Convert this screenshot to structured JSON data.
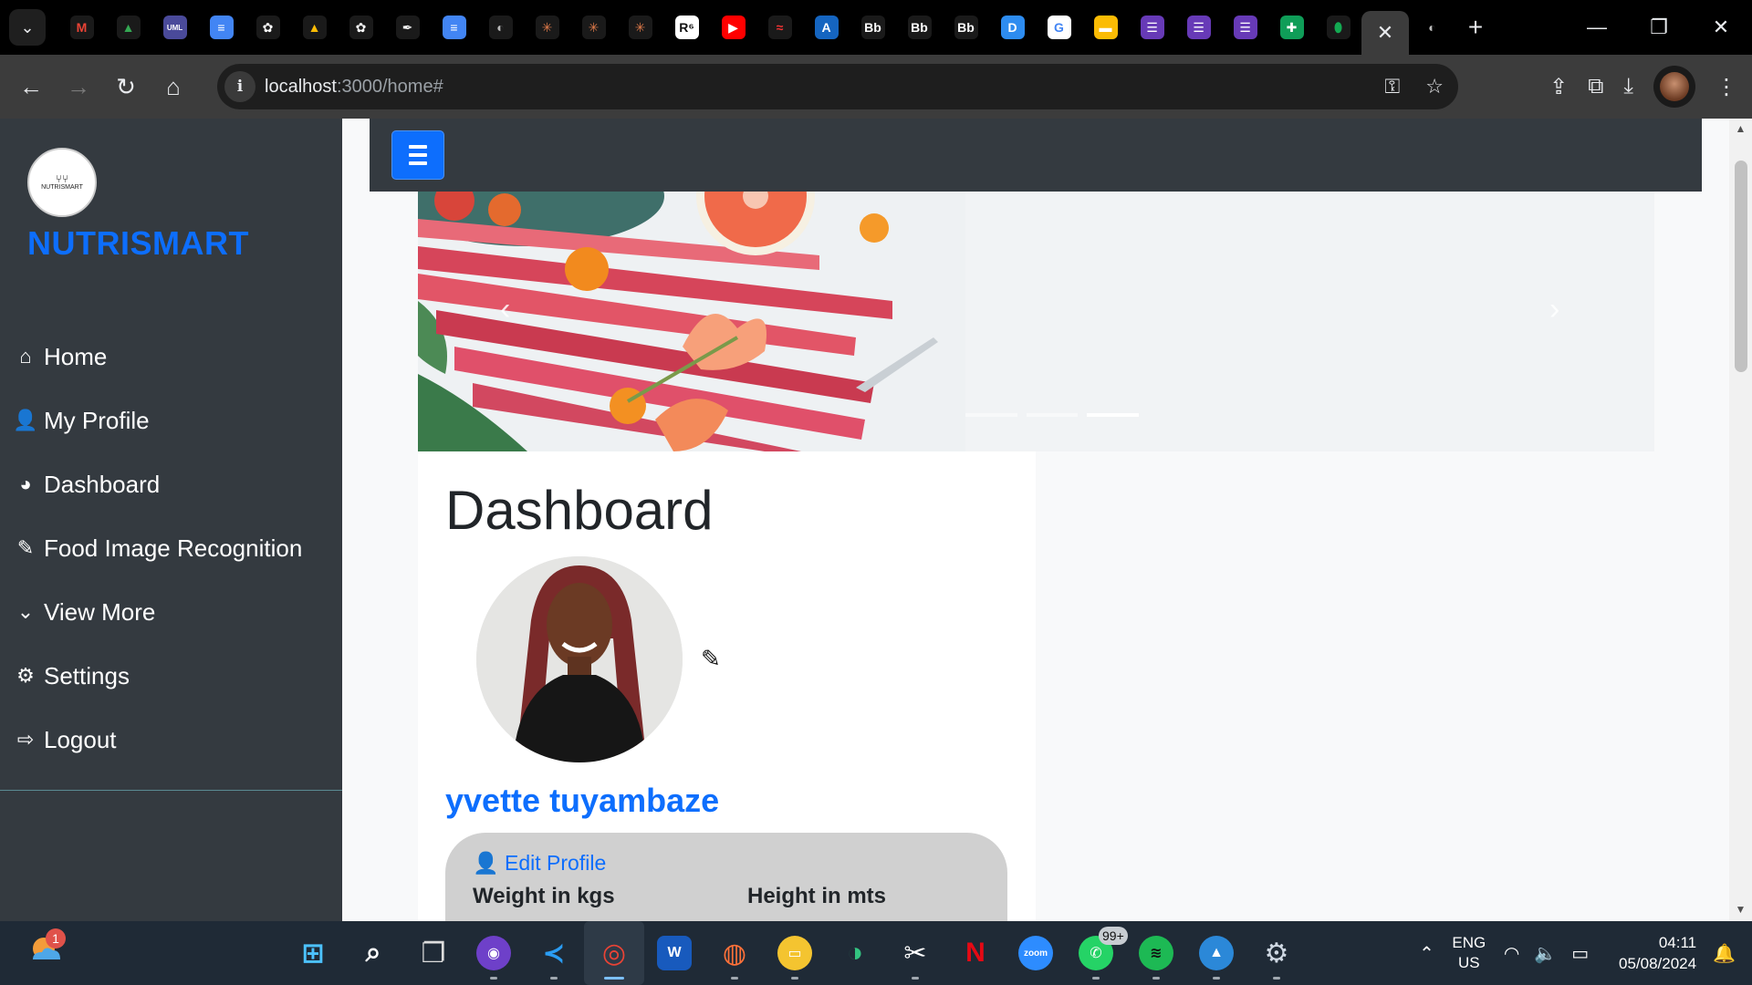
{
  "browser": {
    "tab_favicons": [
      {
        "name": "gmail-icon",
        "glyph": "M",
        "bg": "#1a1a1a",
        "color": "#ea4335"
      },
      {
        "name": "google-drive-icon",
        "glyph": "▲",
        "bg": "#1a1a1a",
        "color": "#34a853"
      },
      {
        "name": "uml-icon",
        "glyph": "UML",
        "bg": "#4a4a9a",
        "color": "#ffffff"
      },
      {
        "name": "google-docs-icon",
        "glyph": "≡",
        "bg": "#4285f4",
        "color": "#ffffff"
      },
      {
        "name": "chatgpt-icon",
        "glyph": "✿",
        "bg": "#1a1a1a",
        "color": "#ffffff"
      },
      {
        "name": "google-drive-icon",
        "glyph": "▲",
        "bg": "#1a1a1a",
        "color": "#fbbc04"
      },
      {
        "name": "chatgpt-icon",
        "glyph": "✿",
        "bg": "#1a1a1a",
        "color": "#ffffff"
      },
      {
        "name": "notion-icon",
        "glyph": "✒",
        "bg": "#1a1a1a",
        "color": "#ffffff"
      },
      {
        "name": "google-docs-icon",
        "glyph": "≡",
        "bg": "#4285f4",
        "color": "#ffffff"
      },
      {
        "name": "globe-icon",
        "glyph": "◐",
        "bg": "#1a1a1a",
        "color": "#bbbbbb"
      },
      {
        "name": "claude-icon",
        "glyph": "✳",
        "bg": "#1a1a1a",
        "color": "#e07a4a"
      },
      {
        "name": "claude-icon",
        "glyph": "✳",
        "bg": "#1a1a1a",
        "color": "#e07a4a"
      },
      {
        "name": "claude-icon",
        "glyph": "✳",
        "bg": "#1a1a1a",
        "color": "#e07a4a"
      },
      {
        "name": "r6-icon",
        "glyph": "R⁶",
        "bg": "#ffffff",
        "color": "#111111"
      },
      {
        "name": "youtube-icon",
        "glyph": "▶",
        "bg": "#ff0000",
        "color": "#ffffff"
      },
      {
        "name": "wave-icon",
        "glyph": "≈",
        "bg": "#1a1a1a",
        "color": "#e33"
      },
      {
        "name": "a-icon",
        "glyph": "A",
        "bg": "#1565c0",
        "color": "#ffffff"
      },
      {
        "name": "blackboard-icon",
        "glyph": "Bb",
        "bg": "#1a1a1a",
        "color": "#ffffff"
      },
      {
        "name": "blackboard-icon",
        "glyph": "Bb",
        "bg": "#1a1a1a",
        "color": "#ffffff"
      },
      {
        "name": "blackboard-icon",
        "glyph": "Bb",
        "bg": "#1a1a1a",
        "color": "#ffffff"
      },
      {
        "name": "d-icon",
        "glyph": "D",
        "bg": "#2d8cf0",
        "color": "#ffffff"
      },
      {
        "name": "google-icon",
        "glyph": "G",
        "bg": "#ffffff",
        "color": "#4285f4"
      },
      {
        "name": "google-slides-icon",
        "glyph": "▬",
        "bg": "#fbbc04",
        "color": "#ffffff"
      },
      {
        "name": "google-forms-icon",
        "glyph": "☰",
        "bg": "#673ab7",
        "color": "#ffffff"
      },
      {
        "name": "google-forms-icon",
        "glyph": "☰",
        "bg": "#673ab7",
        "color": "#ffffff"
      },
      {
        "name": "google-forms-icon",
        "glyph": "☰",
        "bg": "#673ab7",
        "color": "#ffffff"
      },
      {
        "name": "google-sheets-icon",
        "glyph": "✚",
        "bg": "#0f9d58",
        "color": "#ffffff"
      },
      {
        "name": "mongodb-icon",
        "glyph": "⬮",
        "bg": "#1a1a1a",
        "color": "#13aa52"
      }
    ],
    "active_tab_close": "✕",
    "after_tab_favicon": "◐",
    "new_tab": "+",
    "url_host": "localhost",
    "url_path": ":3000/home#"
  },
  "sidebar": {
    "brand": "NUTRISMART",
    "logo_text": "NUTRISMART",
    "items": [
      {
        "label": "Home",
        "icon": "⌂",
        "name": "sidebar-item-home",
        "icon_name": "home-icon"
      },
      {
        "label": "My Profile",
        "icon": "👤",
        "name": "sidebar-item-my-profile",
        "icon_name": "user-icon"
      },
      {
        "label": "Dashboard",
        "icon": "◕",
        "name": "sidebar-item-dashboard",
        "icon_name": "dashboard-gauge-icon"
      },
      {
        "label": "Food Image Recognition",
        "icon": "✎",
        "name": "sidebar-item-food-image-recognition",
        "icon_name": "carrot-icon"
      },
      {
        "label": "View More",
        "icon": "⌄",
        "name": "sidebar-item-view-more",
        "icon_name": "chevron-down-icon"
      },
      {
        "label": "Settings",
        "icon": "⚙",
        "name": "sidebar-item-settings",
        "icon_name": "gear-icon"
      },
      {
        "label": "Logout",
        "icon": "⇨",
        "name": "sidebar-item-logout",
        "icon_name": "logout-icon"
      }
    ]
  },
  "carousel": {
    "prev": "‹",
    "next": "›",
    "slide_count": 3,
    "active_slide": 3
  },
  "dashboard": {
    "title": "Dashboard",
    "user_name": "yvette tuyambaze",
    "edit_profile": "Edit Profile",
    "weight_label": "Weight in kgs",
    "height_label": "Height in mts"
  },
  "taskbar": {
    "weather_badge": "1",
    "whatsapp_badge": "99+",
    "apps": [
      {
        "name": "start-button",
        "glyph": "⊞",
        "bg": "transparent",
        "color": "#4cc2ff"
      },
      {
        "name": "search-icon",
        "glyph": "⌕",
        "bg": "transparent",
        "color": "#ffffff"
      },
      {
        "name": "task-view-icon",
        "glyph": "❐",
        "bg": "transparent",
        "color": "#dddddd"
      },
      {
        "name": "github-desktop-icon",
        "glyph": "◉",
        "bg": "#6e40c9",
        "color": "#ffffff"
      },
      {
        "name": "vscode-icon",
        "glyph": "≺",
        "bg": "transparent",
        "color": "#2a9df4"
      },
      {
        "name": "chrome-icon",
        "glyph": "◎",
        "bg": "transparent",
        "color": "#ea4335"
      },
      {
        "name": "word-icon",
        "glyph": "W",
        "bg": "#185abd",
        "color": "#ffffff"
      },
      {
        "name": "firefox-icon",
        "glyph": "◍",
        "bg": "transparent",
        "color": "#ff7139"
      },
      {
        "name": "file-explorer-icon",
        "glyph": "▭",
        "bg": "#f4c430",
        "color": "#ffffff"
      },
      {
        "name": "edge-icon",
        "glyph": "◑",
        "bg": "transparent",
        "color": "#33c481"
      },
      {
        "name": "snipping-tool-icon",
        "glyph": "✂",
        "bg": "transparent",
        "color": "#ffffff"
      },
      {
        "name": "netflix-icon",
        "glyph": "N",
        "bg": "transparent",
        "color": "#e50914"
      },
      {
        "name": "zoom-icon",
        "glyph": "zoom",
        "bg": "#2d8cff",
        "color": "#ffffff"
      },
      {
        "name": "whatsapp-icon",
        "glyph": "✆",
        "bg": "#25d366",
        "color": "#ffffff"
      },
      {
        "name": "spotify-icon",
        "glyph": "≋",
        "bg": "#1db954",
        "color": "#111111"
      },
      {
        "name": "photos-icon",
        "glyph": "▲",
        "bg": "#2b88d8",
        "color": "#ffffff"
      },
      {
        "name": "settings-icon",
        "glyph": "⚙",
        "bg": "transparent",
        "color": "#cfd8e3"
      }
    ],
    "lang_top": "ENG",
    "lang_bottom": "US",
    "time": "04:11",
    "date": "05/08/2024"
  }
}
